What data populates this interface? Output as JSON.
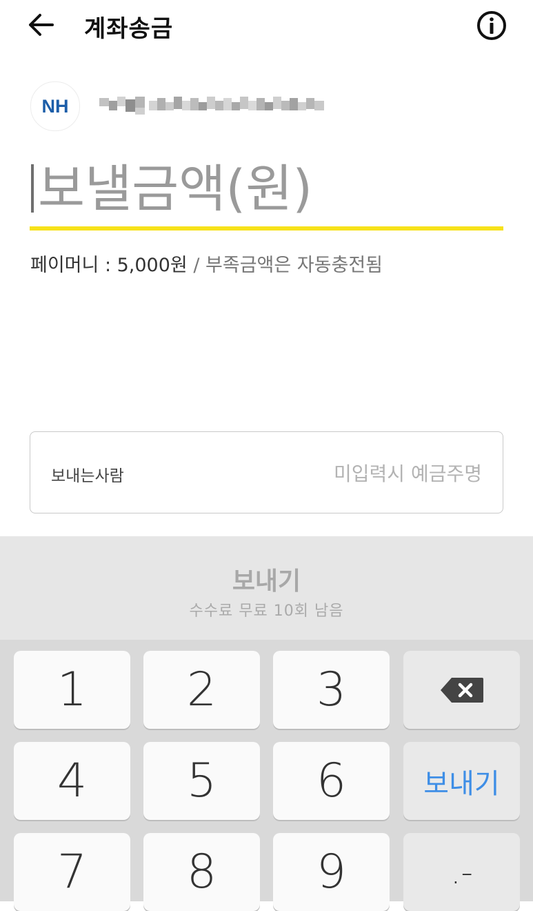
{
  "header": {
    "title": "계좌송금",
    "back_icon": "arrow-left-icon",
    "info_icon": "info-circle-icon"
  },
  "account": {
    "bank_logo_text": "NH"
  },
  "amount": {
    "placeholder": "보낼금액(원)",
    "value": ""
  },
  "balance": {
    "text": "페이머니 : 5,000원",
    "note": " / 부족금액은 자동충전됨"
  },
  "sender": {
    "label": "보내는사람",
    "placeholder": "미입력시 예금주명",
    "value": ""
  },
  "send_button": {
    "label": "보내기",
    "subtitle": "수수료 무료 10회 남음"
  },
  "keypad": {
    "keys": [
      "1",
      "2",
      "3",
      "4",
      "5",
      "6",
      "7",
      "8",
      "9"
    ],
    "backspace_icon": "backspace-icon",
    "send_label": "보내기",
    "symbol_label": ".-"
  },
  "colors": {
    "accent_yellow": "#f7e21a",
    "action_blue": "#3e8ee6",
    "bank_blue": "#1c5ea9"
  }
}
